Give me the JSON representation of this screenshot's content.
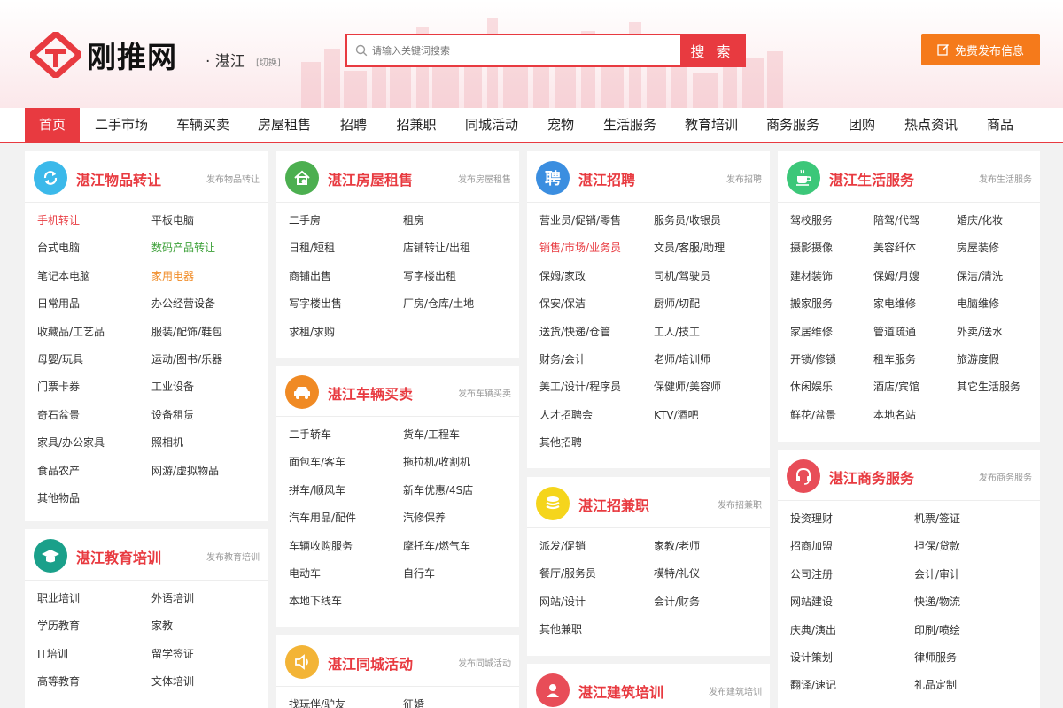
{
  "header": {
    "logo_text": "刚推网",
    "city": "· 湛江",
    "city_switch": "[切换]",
    "search_placeholder": "请输入关键词搜索",
    "search_button": "搜 索",
    "publish_button": "免费发布信息"
  },
  "nav": [
    "首页",
    "二手市场",
    "车辆买卖",
    "房屋租售",
    "招聘",
    "招兼职",
    "同城活动",
    "宠物",
    "生活服务",
    "教育培训",
    "商务服务",
    "团购",
    "热点资讯",
    "商品"
  ],
  "colors": {
    "accent": "#e83a40",
    "publish": "#f57a1b"
  },
  "cards": {
    "wupin": {
      "icon": "refresh-icon",
      "title": "湛江物品转让",
      "link": "发布物品转让",
      "items": [
        [
          "手机转让",
          "red"
        ],
        [
          "平板电脑",
          ""
        ],
        [
          "台式电脑",
          ""
        ],
        [
          "数码产品转让",
          "green"
        ],
        [
          "笔记本电脑",
          ""
        ],
        [
          "家用电器",
          "orange"
        ],
        [
          "日常用品",
          ""
        ],
        [
          "办公经营设备",
          ""
        ],
        [
          "收藏品/工艺品",
          ""
        ],
        [
          "服装/配饰/鞋包",
          ""
        ],
        [
          "母婴/玩具",
          ""
        ],
        [
          "运动/图书/乐器",
          ""
        ],
        [
          "门票卡券",
          ""
        ],
        [
          "工业设备",
          ""
        ],
        [
          "奇石盆景",
          ""
        ],
        [
          "设备租赁",
          ""
        ],
        [
          "家具/办公家具",
          ""
        ],
        [
          "照相机",
          ""
        ],
        [
          "食品农产",
          ""
        ],
        [
          "网游/虚拟物品",
          ""
        ],
        [
          "其他物品",
          ""
        ]
      ]
    },
    "jiaoyu": {
      "icon": "graduation-cap-icon",
      "title": "湛江教育培训",
      "link": "发布教育培训",
      "items": [
        [
          "职业培训",
          ""
        ],
        [
          "外语培训",
          ""
        ],
        [
          "学历教育",
          ""
        ],
        [
          "家教",
          ""
        ],
        [
          "IT培训",
          ""
        ],
        [
          "留学签证",
          ""
        ],
        [
          "高等教育",
          ""
        ],
        [
          "文体培训",
          ""
        ]
      ]
    },
    "fangwu": {
      "icon": "house-icon",
      "title": "湛江房屋租售",
      "link": "发布房屋租售",
      "items": [
        [
          "二手房",
          ""
        ],
        [
          "租房",
          ""
        ],
        [
          "日租/短租",
          ""
        ],
        [
          "店铺转让/出租",
          ""
        ],
        [
          "商铺出售",
          ""
        ],
        [
          "写字楼出租",
          ""
        ],
        [
          "写字楼出售",
          ""
        ],
        [
          "厂房/仓库/土地",
          ""
        ],
        [
          "求租/求购",
          ""
        ]
      ]
    },
    "cheliang": {
      "icon": "car-icon",
      "title": "湛江车辆买卖",
      "link": "发布车辆买卖",
      "items": [
        [
          "二手轿车",
          ""
        ],
        [
          "货车/工程车",
          ""
        ],
        [
          "面包车/客车",
          ""
        ],
        [
          "拖拉机/收割机",
          ""
        ],
        [
          "拼车/顺风车",
          ""
        ],
        [
          "新车优惠/4S店",
          ""
        ],
        [
          "汽车用品/配件",
          ""
        ],
        [
          "汽修保养",
          ""
        ],
        [
          "车辆收购服务",
          ""
        ],
        [
          "摩托车/燃气车",
          ""
        ],
        [
          "电动车",
          ""
        ],
        [
          "自行车",
          ""
        ],
        [
          "本地下线车",
          ""
        ]
      ]
    },
    "tongcheng": {
      "icon": "speaker-icon",
      "title": "湛江同城活动",
      "link": "发布同城活动",
      "items": [
        [
          "找玩伴/驴友",
          ""
        ],
        [
          "征婚",
          ""
        ]
      ]
    },
    "zhaopin": {
      "icon": "pin-char-icon",
      "icon_char": "聘",
      "title": "湛江招聘",
      "link": "发布招聘",
      "items": [
        [
          "营业员/促销/零售",
          ""
        ],
        [
          "服务员/收银员",
          ""
        ],
        [
          "销售/市场/业务员",
          "red"
        ],
        [
          "文员/客服/助理",
          ""
        ],
        [
          "保姆/家政",
          ""
        ],
        [
          "司机/驾驶员",
          ""
        ],
        [
          "保安/保洁",
          ""
        ],
        [
          "厨师/切配",
          ""
        ],
        [
          "送货/快递/仓管",
          ""
        ],
        [
          "工人/技工",
          ""
        ],
        [
          "财务/会计",
          ""
        ],
        [
          "老师/培训师",
          ""
        ],
        [
          "美工/设计/程序员",
          ""
        ],
        [
          "保健师/美容师",
          ""
        ],
        [
          "人才招聘会",
          ""
        ],
        [
          "KTV/酒吧",
          ""
        ],
        [
          "其他招聘",
          ""
        ]
      ]
    },
    "jianzhi": {
      "icon": "coins-icon",
      "title": "湛江招兼职",
      "link": "发布招兼职",
      "items": [
        [
          "派发/促销",
          ""
        ],
        [
          "家教/老师",
          ""
        ],
        [
          "餐厅/服务员",
          ""
        ],
        [
          "模特/礼仪",
          ""
        ],
        [
          "网站/设计",
          ""
        ],
        [
          "会计/财务",
          ""
        ],
        [
          "其他兼职",
          ""
        ]
      ]
    },
    "jianzhu": {
      "icon": "worker-icon",
      "title": "湛江建筑培训",
      "link": "发布建筑培训",
      "items": []
    },
    "shenghuo": {
      "icon": "teacup-icon",
      "title": "湛江生活服务",
      "link": "发布生活服务",
      "items": [
        [
          "驾校服务",
          ""
        ],
        [
          "陪驾/代驾",
          ""
        ],
        [
          "婚庆/化妆",
          ""
        ],
        [
          "摄影摄像",
          ""
        ],
        [
          "美容纤体",
          ""
        ],
        [
          "房屋装修",
          ""
        ],
        [
          "建材装饰",
          ""
        ],
        [
          "保姆/月嫂",
          ""
        ],
        [
          "保洁/清洗",
          ""
        ],
        [
          "搬家服务",
          ""
        ],
        [
          "家电维修",
          ""
        ],
        [
          "电脑维修",
          ""
        ],
        [
          "家居维修",
          ""
        ],
        [
          "管道疏通",
          ""
        ],
        [
          "外卖/送水",
          ""
        ],
        [
          "开锁/修锁",
          ""
        ],
        [
          "租车服务",
          ""
        ],
        [
          "旅游度假",
          ""
        ],
        [
          "休闲娱乐",
          ""
        ],
        [
          "酒店/宾馆",
          ""
        ],
        [
          "其它生活服务",
          ""
        ],
        [
          "鲜花/盆景",
          ""
        ],
        [
          "本地名站",
          ""
        ]
      ]
    },
    "shangwu": {
      "icon": "headset-icon",
      "title": "湛江商务服务",
      "link": "发布商务服务",
      "items": [
        [
          "投资理财",
          ""
        ],
        [
          "机票/签证",
          ""
        ],
        [
          "招商加盟",
          ""
        ],
        [
          "担保/贷款",
          ""
        ],
        [
          "公司注册",
          ""
        ],
        [
          "会计/审计",
          ""
        ],
        [
          "网站建设",
          ""
        ],
        [
          "快递/物流",
          ""
        ],
        [
          "庆典/演出",
          ""
        ],
        [
          "印刷/喷绘",
          ""
        ],
        [
          "设计策划",
          ""
        ],
        [
          "律师服务",
          ""
        ],
        [
          "翻译/速记",
          ""
        ],
        [
          "礼品定制",
          ""
        ]
      ]
    }
  }
}
